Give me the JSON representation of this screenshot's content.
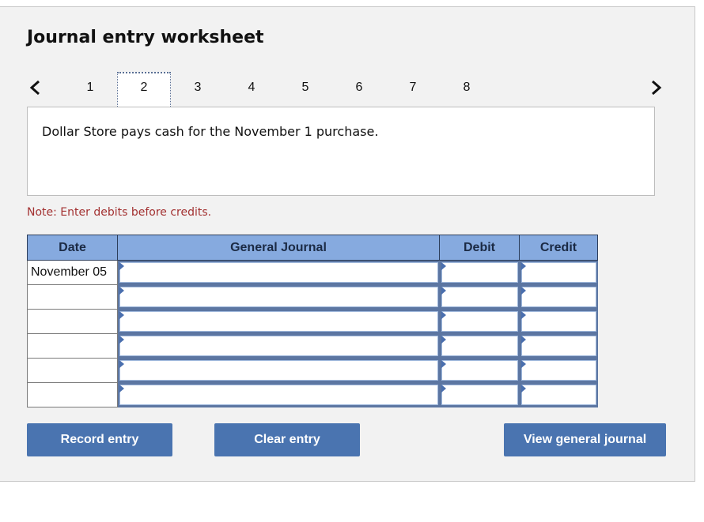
{
  "title": "Journal entry worksheet",
  "nav": {
    "prev_icon": "chevron-left-icon",
    "next_icon": "chevron-right-icon",
    "tabs": [
      "1",
      "2",
      "3",
      "4",
      "5",
      "6",
      "7",
      "8"
    ],
    "active_tab": "2"
  },
  "prompt": "Dollar Store pays cash for the November 1 purchase.",
  "note": "Note: Enter debits before credits.",
  "table": {
    "headers": {
      "date": "Date",
      "general_journal": "General Journal",
      "debit": "Debit",
      "credit": "Credit"
    },
    "rows": [
      {
        "date": "November 05",
        "account": "",
        "debit": "",
        "credit": ""
      },
      {
        "date": "",
        "account": "",
        "debit": "",
        "credit": ""
      },
      {
        "date": "",
        "account": "",
        "debit": "",
        "credit": ""
      },
      {
        "date": "",
        "account": "",
        "debit": "",
        "credit": ""
      },
      {
        "date": "",
        "account": "",
        "debit": "",
        "credit": ""
      },
      {
        "date": "",
        "account": "",
        "debit": "",
        "credit": ""
      }
    ]
  },
  "buttons": {
    "record": "Record entry",
    "clear": "Clear entry",
    "view": "View general journal"
  },
  "colors": {
    "button_bg": "#4a74b0",
    "header_bg": "#86aadf",
    "note_text": "#a33232",
    "panel_bg": "#f2f2f2"
  }
}
